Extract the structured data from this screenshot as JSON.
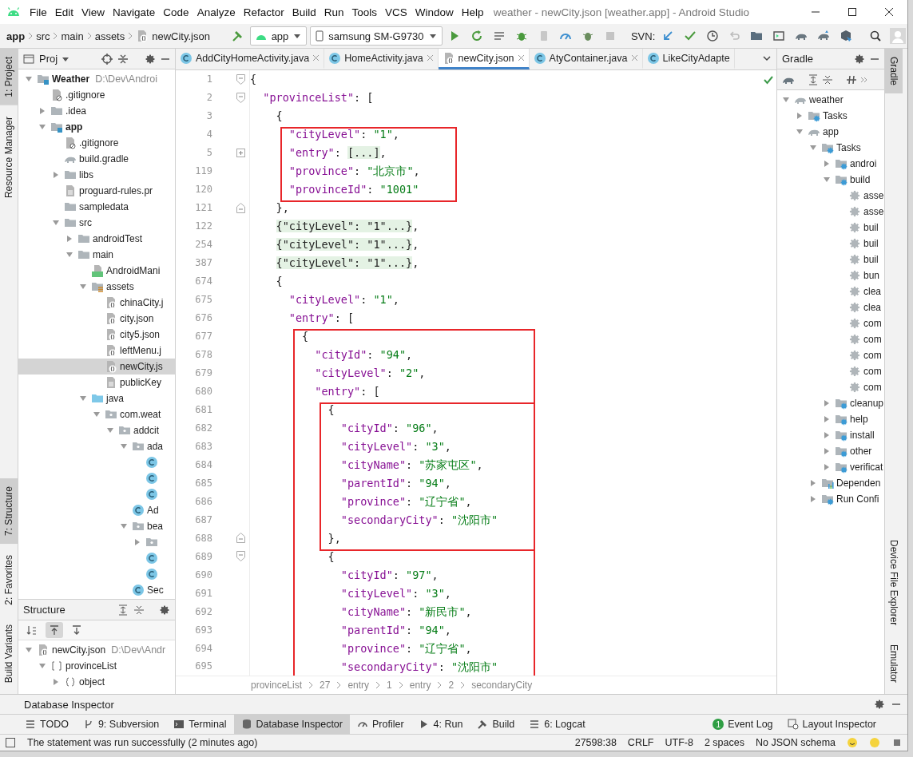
{
  "window": {
    "title": "weather - newCity.json [weather.app] - Android Studio"
  },
  "menu": [
    "File",
    "Edit",
    "View",
    "Navigate",
    "Code",
    "Analyze",
    "Refactor",
    "Build",
    "Run",
    "Tools",
    "VCS",
    "Window",
    "Help"
  ],
  "nav": {
    "breadcrumbs": [
      "app",
      "src",
      "main",
      "assets",
      "newCity.json"
    ],
    "run_config": "app",
    "device": "samsung SM-G9730",
    "svn_label": "SVN:"
  },
  "left_strip_top": [
    {
      "label": "1: Project",
      "selected": true
    },
    {
      "label": "Resource Manager",
      "selected": false
    }
  ],
  "left_strip_bottom": [
    {
      "label": "7: Structure",
      "selected": true
    },
    {
      "label": "2: Favorites",
      "selected": false
    },
    {
      "label": "Build Variants",
      "selected": false
    }
  ],
  "right_strip_top": [
    {
      "label": "Gradle",
      "selected": true
    }
  ],
  "right_strip_bottom": [
    {
      "label": "Device File Explorer",
      "selected": false
    },
    {
      "label": "Emulator",
      "selected": false
    }
  ],
  "project": {
    "title": "Proj",
    "tree": [
      {
        "label": "Weather",
        "hint": "D:\\Dev\\Androi",
        "kind": "module",
        "expanded": true,
        "selected": false,
        "children": [
          {
            "label": ".gitignore",
            "kind": "ignore",
            "selected": false
          },
          {
            "label": ".idea",
            "kind": "folder",
            "expanded": false,
            "selected": false
          },
          {
            "label": "app",
            "kind": "module",
            "expanded": true,
            "selected": false,
            "children": [
              {
                "label": ".gitignore",
                "kind": "ignore",
                "selected": false
              },
              {
                "label": "build.gradle",
                "kind": "gradle",
                "selected": false
              },
              {
                "label": "libs",
                "kind": "folder",
                "expanded": false,
                "selected": false
              },
              {
                "label": "proguard-rules.pr",
                "kind": "text",
                "selected": false
              },
              {
                "label": "sampledata",
                "kind": "folder",
                "selected": false
              },
              {
                "label": "src",
                "kind": "folder",
                "expanded": true,
                "selected": false,
                "children": [
                  {
                    "label": "androidTest",
                    "kind": "folder",
                    "expanded": false,
                    "selected": false
                  },
                  {
                    "label": "main",
                    "kind": "folder",
                    "expanded": true,
                    "selected": false,
                    "children": [
                      {
                        "label": "AndroidMani",
                        "kind": "manifest",
                        "selected": false
                      },
                      {
                        "label": "assets",
                        "kind": "assets",
                        "expanded": true,
                        "selected": false,
                        "children": [
                          {
                            "label": "chinaCity.j",
                            "kind": "json",
                            "selected": false
                          },
                          {
                            "label": "city.json",
                            "kind": "json",
                            "selected": false
                          },
                          {
                            "label": "city5.json",
                            "kind": "json",
                            "selected": false
                          },
                          {
                            "label": "leftMenu.j",
                            "kind": "json",
                            "selected": false
                          },
                          {
                            "label": "newCity.js",
                            "kind": "json",
                            "selected": true
                          },
                          {
                            "label": "publicKey",
                            "kind": "text",
                            "selected": false
                          }
                        ]
                      },
                      {
                        "label": "java",
                        "kind": "source",
                        "expanded": true,
                        "selected": false,
                        "children": [
                          {
                            "label": "com.weat",
                            "kind": "package",
                            "expanded": true,
                            "selected": false,
                            "children": [
                              {
                                "label": "addcit",
                                "kind": "package",
                                "expanded": true,
                                "selected": false,
                                "children": [
                                  {
                                    "label": "ada",
                                    "kind": "package",
                                    "expanded": true,
                                    "selected": false,
                                    "children": [
                                      {
                                        "kind": "class",
                                        "selected": false
                                      },
                                      {
                                        "kind": "class",
                                        "selected": false
                                      },
                                      {
                                        "kind": "class",
                                        "selected": false
                                      }
                                    ]
                                  },
                                  {
                                    "label": "Ad",
                                    "kind": "class",
                                    "selected": false
                                  },
                                  {
                                    "label": "bea",
                                    "kind": "package",
                                    "expanded": true,
                                    "selected": false,
                                    "children": [
                                      {
                                        "kind": "package",
                                        "expanded": false,
                                        "selected": false
                                      },
                                      {
                                        "kind": "class",
                                        "selected": false
                                      },
                                      {
                                        "kind": "class",
                                        "selected": false
                                      }
                                    ]
                                  },
                                  {
                                    "label": "Sec",
                                    "kind": "class",
                                    "selected": false
                                  }
                                ]
                              }
                            ]
                          }
                        ]
                      }
                    ]
                  }
                ]
              }
            ]
          }
        ]
      }
    ]
  },
  "structure": {
    "title": "Structure",
    "toolbar": [
      {
        "kind": "sort",
        "pressed": false
      },
      {
        "kind": "scroll-from",
        "pressed": true
      },
      {
        "kind": "scroll-to",
        "pressed": false
      }
    ],
    "tree": [
      {
        "label": "newCity.json",
        "hint": "D:\\Dev\\Andr",
        "kind": "json",
        "expanded": true,
        "children": [
          {
            "label": "provinceList",
            "kind": "array",
            "expanded": true,
            "children": [
              {
                "label": "object",
                "kind": "object",
                "expanded": false
              }
            ]
          }
        ]
      }
    ]
  },
  "editor": {
    "tabs": [
      {
        "label": "AddCityHomeActivity.java",
        "kind": "class",
        "selected": false
      },
      {
        "label": "HomeActivity.java",
        "kind": "class",
        "selected": false
      },
      {
        "label": "newCity.json",
        "kind": "json",
        "selected": true
      },
      {
        "label": "AtyContainer.java",
        "kind": "class",
        "selected": false
      },
      {
        "label": "LikeCityAdapte",
        "kind": "class",
        "selected": false
      }
    ],
    "lines": [
      {
        "number": "1",
        "text": "{",
        "gutter": {
          "kind": "open"
        }
      },
      {
        "number": "2",
        "text": "  \"provinceList\": [",
        "gutter": {
          "kind": "open"
        }
      },
      {
        "number": "3",
        "text": "    {"
      },
      {
        "number": "4",
        "text": "      \"cityLevel\": \"1\",",
        "outer_box": true
      },
      {
        "number": "5",
        "text": "      \"entry\": [...],",
        "outer_box": true,
        "folded": true,
        "gutter": {
          "kind": "plus"
        }
      },
      {
        "number": "119",
        "text": "      \"province\": \"北京市\",",
        "outer_box": true
      },
      {
        "number": "120",
        "text": "      \"provinceId\": \"1001\"",
        "outer_box": true
      },
      {
        "number": "121",
        "text": "    },",
        "gutter": {
          "kind": "close"
        }
      },
      {
        "number": "122",
        "text": "    {\"cityLevel\": \"1\"...},",
        "folded": true
      },
      {
        "number": "254",
        "text": "    {\"cityLevel\": \"1\"...},",
        "folded": true
      },
      {
        "number": "387",
        "text": "    {\"cityLevel\": \"1\"...},",
        "folded": true
      },
      {
        "number": "674",
        "text": "    {"
      },
      {
        "number": "675",
        "text": "      \"cityLevel\": \"1\","
      },
      {
        "number": "676",
        "text": "      \"entry\": ["
      },
      {
        "number": "677",
        "text": "        {",
        "outer_box": true
      },
      {
        "number": "678",
        "text": "          \"cityId\": \"94\",",
        "outer_box": true
      },
      {
        "number": "679",
        "text": "          \"cityLevel\": \"2\",",
        "outer_box": true
      },
      {
        "number": "680",
        "text": "          \"entry\": [",
        "outer_box": true
      },
      {
        "number": "681",
        "text": "            {",
        "outer_box": true,
        "inner_box": true
      },
      {
        "number": "682",
        "text": "              \"cityId\": \"96\",",
        "outer_box": true,
        "inner_box": true
      },
      {
        "number": "683",
        "text": "              \"cityLevel\": \"3\",",
        "outer_box": true,
        "inner_box": true
      },
      {
        "number": "684",
        "text": "              \"cityName\": \"苏家屯区\",",
        "outer_box": true,
        "inner_box": true
      },
      {
        "number": "685",
        "text": "              \"parentId\": \"94\",",
        "outer_box": true,
        "inner_box": true
      },
      {
        "number": "686",
        "text": "              \"province\": \"辽宁省\",",
        "outer_box": true,
        "inner_box": true
      },
      {
        "number": "687",
        "text": "              \"secondaryCity\": \"沈阳市\"",
        "outer_box": true,
        "inner_box": true
      },
      {
        "number": "688",
        "text": "            },",
        "outer_box": true,
        "inner_box": true,
        "gutter": {
          "kind": "close"
        }
      },
      {
        "number": "689",
        "text": "            {",
        "outer_box": true,
        "gutter": {
          "kind": "open"
        }
      },
      {
        "number": "690",
        "text": "              \"cityId\": \"97\",",
        "outer_box": true
      },
      {
        "number": "691",
        "text": "              \"cityLevel\": \"3\",",
        "outer_box": true
      },
      {
        "number": "692",
        "text": "              \"cityName\": \"新民市\",",
        "outer_box": true
      },
      {
        "number": "693",
        "text": "              \"parentId\": \"94\",",
        "outer_box": true
      },
      {
        "number": "694",
        "text": "              \"province\": \"辽宁省\",",
        "outer_box": true
      },
      {
        "number": "695",
        "text": "              \"secondaryCity\": \"沈阳市\"",
        "outer_box": true
      }
    ],
    "breadcrumb": [
      "provinceList",
      "27",
      "entry",
      "1",
      "entry",
      "2",
      "secondaryCity"
    ]
  },
  "gradle": {
    "title": "Gradle",
    "tree": [
      {
        "label": "weather",
        "kind": "elephant",
        "expanded": true,
        "children": [
          {
            "label": "Tasks",
            "kind": "task-folder",
            "expanded": false
          },
          {
            "label": "app",
            "kind": "elephant",
            "expanded": true,
            "children": [
              {
                "label": "Tasks",
                "kind": "task-folder",
                "expanded": true,
                "children": [
                  {
                    "label": "androi",
                    "kind": "task-folder",
                    "expanded": false
                  },
                  {
                    "label": "build",
                    "kind": "task-folder",
                    "expanded": true,
                    "children": [
                      {
                        "label": "asse",
                        "kind": "gear"
                      },
                      {
                        "label": "asse",
                        "kind": "gear"
                      },
                      {
                        "label": "buil",
                        "kind": "gear"
                      },
                      {
                        "label": "buil",
                        "kind": "gear"
                      },
                      {
                        "label": "buil",
                        "kind": "gear"
                      },
                      {
                        "label": "bun",
                        "kind": "gear"
                      },
                      {
                        "label": "clea",
                        "kind": "gear"
                      },
                      {
                        "label": "clea",
                        "kind": "gear"
                      },
                      {
                        "label": "com",
                        "kind": "gear"
                      },
                      {
                        "label": "com",
                        "kind": "gear"
                      },
                      {
                        "label": "com",
                        "kind": "gear"
                      },
                      {
                        "label": "com",
                        "kind": "gear"
                      },
                      {
                        "label": "com",
                        "kind": "gear"
                      }
                    ]
                  },
                  {
                    "label": "cleanup",
                    "kind": "task-folder",
                    "expanded": false
                  },
                  {
                    "label": "help",
                    "kind": "task-folder",
                    "expanded": false
                  },
                  {
                    "label": "install",
                    "kind": "task-folder",
                    "expanded": false
                  },
                  {
                    "label": "other",
                    "kind": "task-folder",
                    "expanded": false
                  },
                  {
                    "label": "verificat",
                    "kind": "task-folder",
                    "expanded": false
                  }
                ]
              },
              {
                "label": "Dependen",
                "kind": "deps",
                "expanded": false
              },
              {
                "label": "Run Confi",
                "kind": "task-folder",
                "expanded": false
              }
            ]
          }
        ]
      }
    ]
  },
  "bottom_panel": {
    "title": "Database Inspector"
  },
  "tool_tabs": [
    {
      "label": "TODO",
      "kind": "list",
      "selected": false
    },
    {
      "label": "9: Subversion",
      "kind": "branch",
      "selected": false
    },
    {
      "label": "Terminal",
      "kind": "terminal",
      "selected": false
    },
    {
      "label": "Database Inspector",
      "kind": "database",
      "selected": true
    },
    {
      "label": "Profiler",
      "kind": "gauge",
      "selected": false
    },
    {
      "label": "4: Run",
      "kind": "run",
      "selected": false
    },
    {
      "label": "Build",
      "kind": "hammer",
      "selected": false
    },
    {
      "label": "6: Logcat",
      "kind": "list",
      "selected": false
    }
  ],
  "right_tabs": [
    {
      "label": "Event Log",
      "badge": "1"
    },
    {
      "label": "Layout Inspector"
    }
  ],
  "status": {
    "message": "The statement was run successfully (2 minutes ago)",
    "position": "27598:38",
    "line_separator": "CRLF",
    "encoding": "UTF-8",
    "indent": "2 spaces",
    "schema": "No JSON schema"
  }
}
